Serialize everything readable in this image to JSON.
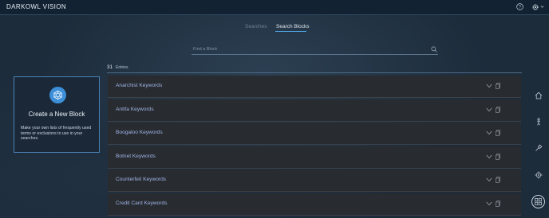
{
  "app": {
    "logo_text": "DARKOWL VISION"
  },
  "header": {
    "icons": [
      "help-icon",
      "gear-icon",
      "chevron-down-icon"
    ]
  },
  "tabs": [
    {
      "label": "Searches",
      "active": false
    },
    {
      "label": "Search Blocks",
      "active": true
    }
  ],
  "search": {
    "placeholder": "Find a Block",
    "value": ""
  },
  "entries": {
    "count": "31",
    "label": "Entries"
  },
  "create_card": {
    "title": "Create a New Block",
    "description": "Make your own lists of frequently used terms or exclusions to use in your searches.",
    "icon": "cube-network-icon"
  },
  "blocks": [
    {
      "name": "Anarchist Keywords"
    },
    {
      "name": "Antifa Keywords"
    },
    {
      "name": "Boogaloo Keywords"
    },
    {
      "name": "Botnet Keywords"
    },
    {
      "name": "Counterfeit Keywords"
    },
    {
      "name": "Credit Card Keywords"
    }
  ],
  "rail": {
    "icons": [
      "home-icon",
      "person-icon",
      "pin-icon",
      "target-icon",
      "grid-icon"
    ]
  },
  "colors": {
    "background": "#1d2c3b",
    "topbar": "#132232",
    "accent": "#4fa3e0",
    "row_background": "#282b2f",
    "block_name": "#9fb5ea",
    "card_border": "#4a83b6"
  }
}
